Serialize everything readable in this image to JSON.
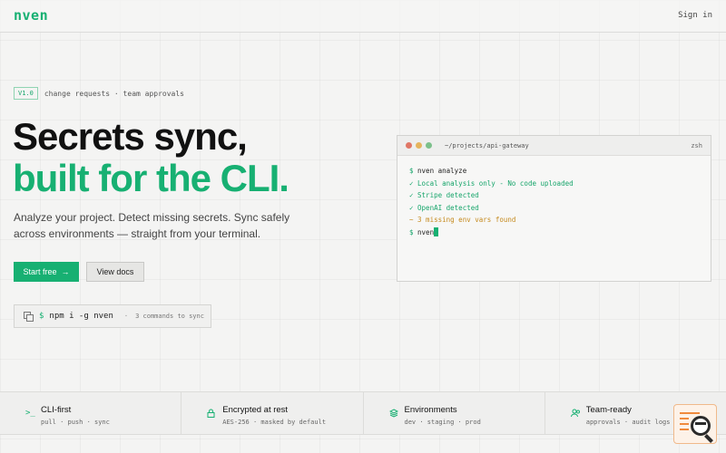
{
  "header": {
    "logo": "nven",
    "signin_label": "Sign in"
  },
  "hero": {
    "version_badge": "V1.0",
    "version_text": "change requests · team approvals",
    "headline_line1": "Secrets sync,",
    "headline_line2": "built for the CLI.",
    "subtext": "Analyze your project. Detect missing secrets. Sync safely across environments — straight from your terminal.",
    "primary_button": "Start free",
    "primary_button_arrow": "→",
    "secondary_button": "View docs",
    "install": {
      "prompt": "$",
      "command": "npm i -g nven",
      "separator": "·",
      "hint": "3 commands to sync"
    }
  },
  "terminal": {
    "path": "~/projects/api-gateway",
    "shell": "zsh",
    "lines": [
      {
        "prefix": "$",
        "text": "nven analyze",
        "style": "cmd"
      },
      {
        "prefix": "✓",
        "text": "Local analysis only - No code uploaded",
        "style": "ok"
      },
      {
        "prefix": "✓",
        "text": "Stripe detected",
        "style": "ok"
      },
      {
        "prefix": "✓",
        "text": "OpenAI detected",
        "style": "ok"
      },
      {
        "prefix": "~",
        "text": "3 missing env vars found",
        "style": "warn"
      },
      {
        "prefix": "$",
        "text": "nven",
        "style": "cmd"
      }
    ]
  },
  "features": [
    {
      "icon": "terminal-icon",
      "glyph": ">_",
      "title": "CLI-first",
      "subtitle": "pull · push · sync"
    },
    {
      "icon": "lock-icon",
      "glyph": "🔒",
      "title": "Encrypted at rest",
      "subtitle": "AES-256 · masked by default"
    },
    {
      "icon": "layers-icon",
      "glyph": "◈",
      "title": "Environments",
      "subtitle": "dev · staging · prod"
    },
    {
      "icon": "users-icon",
      "glyph": "⚇",
      "title": "Team-ready",
      "subtitle": "approvals · audit logs"
    }
  ],
  "colors": {
    "accent": "#17b072",
    "background": "#f4f4f3",
    "warn": "#c58a1e"
  }
}
